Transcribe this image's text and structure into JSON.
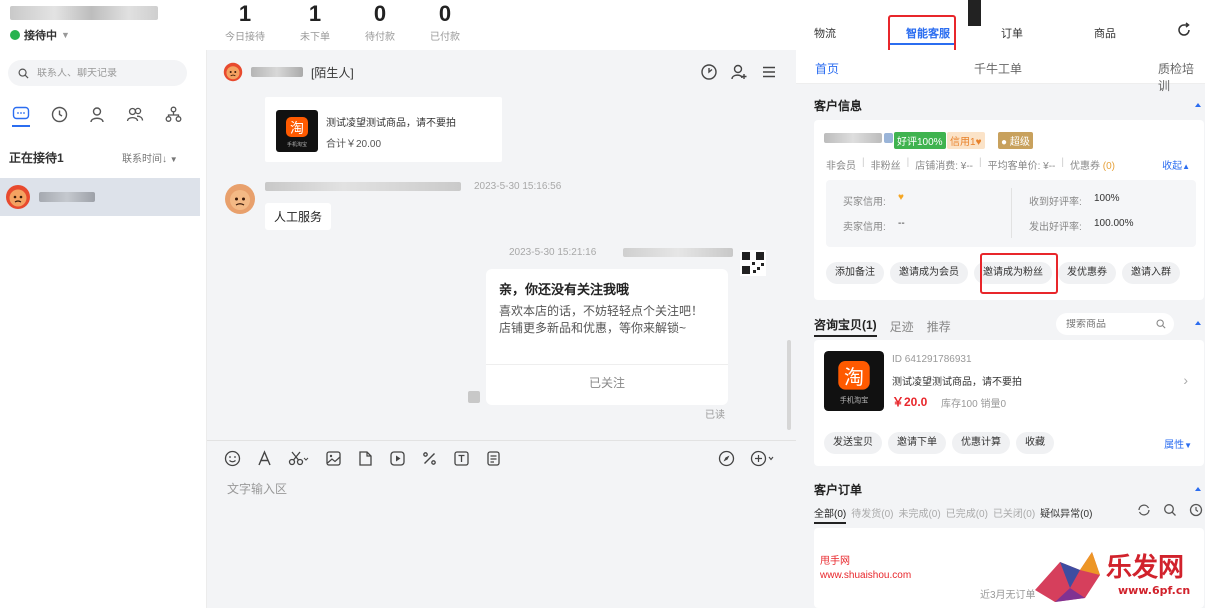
{
  "header": {
    "status": "接待中",
    "stats": [
      {
        "num": "1",
        "label": "今日接待"
      },
      {
        "num": "1",
        "label": "未下单"
      },
      {
        "num": "0",
        "label": "待付款"
      },
      {
        "num": "0",
        "label": "已付款"
      }
    ]
  },
  "sidebar": {
    "search_placeholder": "联系人、聊天记录",
    "receiving_label": "正在接待1",
    "sort_label": "联系时间↓"
  },
  "chat": {
    "contact_tag": "[陌生人]",
    "order_card": {
      "title": "测试凌望测试商品，请不要拍",
      "total": "合计￥20.00"
    },
    "msg1_time": "2023-5-30 15:16:56",
    "msg1_text": "人工服务",
    "msg2_time": "2023-5-30 15:21:16",
    "follow_card": {
      "title": "亲，你还没有关注我哦",
      "body": "喜欢本店的话，不妨轻轻点个关注吧！店铺更多新品和优惠，等你来解锁~",
      "button": "已关注"
    },
    "read_label": "已读",
    "input_placeholder": "文字输入区",
    "thumb_caption": "手机淘宝",
    "thumb_char": "淘"
  },
  "right": {
    "tabs": [
      "物流",
      "智能客服",
      "订单",
      "商品"
    ],
    "subtabs": [
      "首页",
      "千牛工单",
      "质检培训"
    ],
    "customer": {
      "section_title": "客户信息",
      "tag_rating": "好评100%",
      "tag_credit": "信用1",
      "tag_super": "超级",
      "meta": [
        "非会员",
        "非粉丝",
        "店铺消费: ¥--",
        "平均客单价: ¥--"
      ],
      "coupon": "优惠券",
      "coupon_count": "(0)",
      "collapse": "收起",
      "buyer_credit_k": "买家信用:",
      "seller_credit_k": "卖家信用:",
      "seller_credit_v": "--",
      "good_recv_k": "收到好评率:",
      "good_recv_v": "100%",
      "good_send_k": "发出好评率:",
      "good_send_v": "100.00%",
      "actions": [
        "添加备注",
        "邀请成为会员",
        "邀请成为粉丝",
        "发优惠券",
        "邀请入群"
      ]
    },
    "product": {
      "tabs": [
        "咨询宝贝(1)",
        "足迹",
        "推荐"
      ],
      "search_placeholder": "搜索商品",
      "id": "ID 641291786931",
      "title": "测试凌望测试商品，请不要拍",
      "price": "￥20.0",
      "stock": "库存100  销量0",
      "actions": [
        "发送宝贝",
        "邀请下单",
        "优惠计算",
        "收藏"
      ],
      "attr": "属性"
    },
    "orders": {
      "section_title": "客户订单",
      "tabs": [
        "全部(0)",
        "待发货(0)",
        "未完成(0)",
        "已完成(0)",
        "已关闭(0)",
        "疑似异常(0)"
      ],
      "empty": "近3月无订单"
    }
  },
  "watermark": {
    "site": "甩手网",
    "url": "www.shuaishou.com",
    "logo_text": "乐发网",
    "logo_url": "www.6pf.cn"
  },
  "colors": {
    "accent": "#2b6df0",
    "highlight": "#e8262b",
    "online": "#27b34f",
    "panel_bg": "#f3f4f6"
  }
}
